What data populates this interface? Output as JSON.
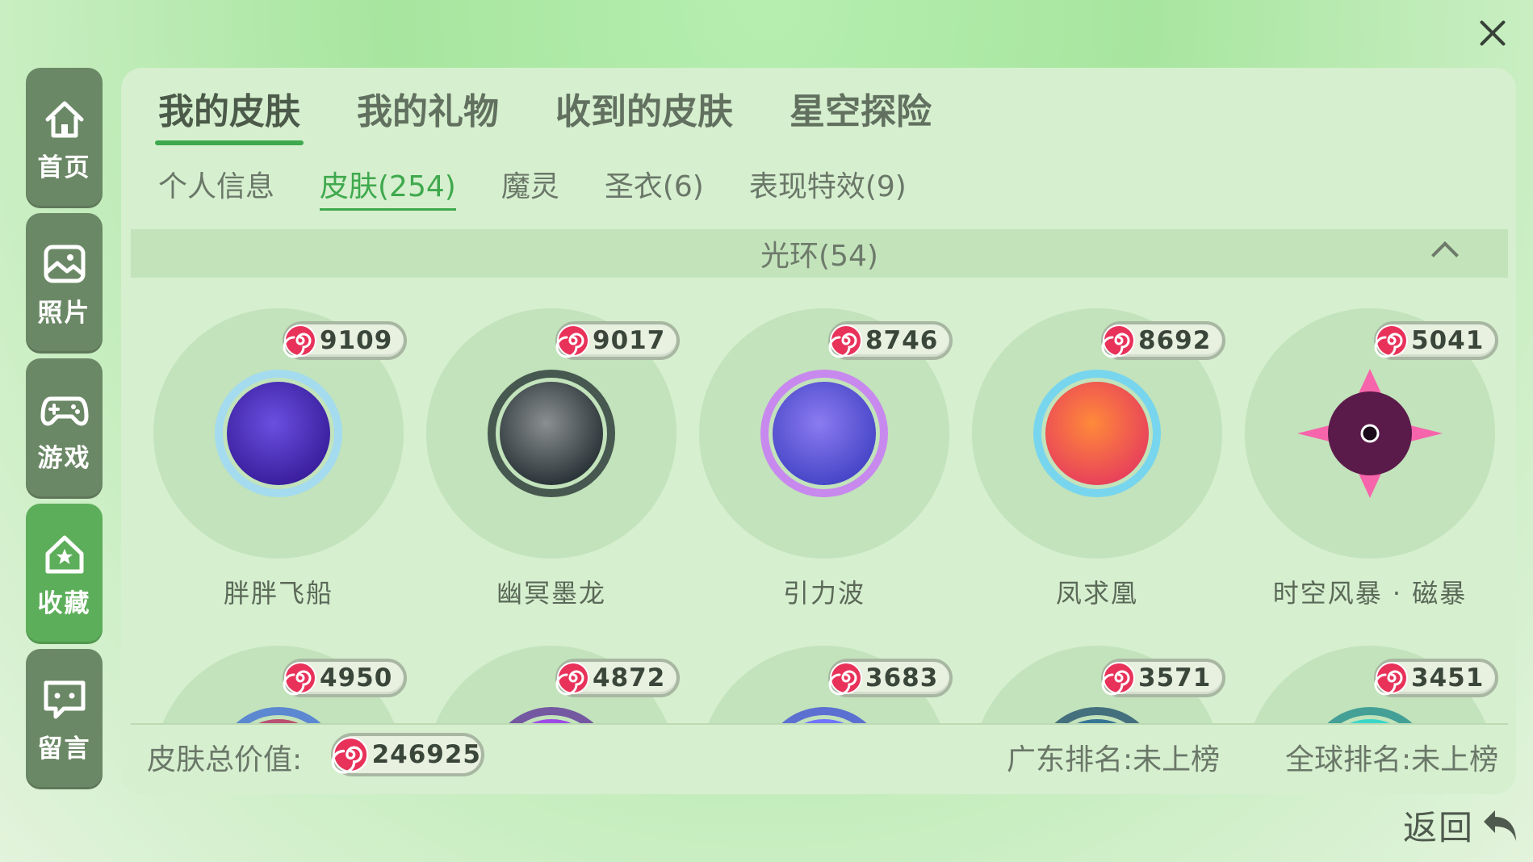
{
  "close_icon": "close-icon",
  "sidebar": {
    "items": [
      {
        "label": "首页",
        "icon": "home-icon",
        "active": false
      },
      {
        "label": "照片",
        "icon": "photo-icon",
        "active": false
      },
      {
        "label": "游戏",
        "icon": "gamepad-icon",
        "active": false
      },
      {
        "label": "收藏",
        "icon": "star-house-icon",
        "active": true
      },
      {
        "label": "留言",
        "icon": "message-icon",
        "active": false
      }
    ]
  },
  "tabs": [
    {
      "label": "我的皮肤",
      "active": true
    },
    {
      "label": "我的礼物",
      "active": false
    },
    {
      "label": "收到的皮肤",
      "active": false
    },
    {
      "label": "星空探险",
      "active": false
    }
  ],
  "subtabs": [
    {
      "label": "个人信息",
      "active": false
    },
    {
      "label": "皮肤(254)",
      "active": true
    },
    {
      "label": "魔灵",
      "active": false
    },
    {
      "label": "圣衣(6)",
      "active": false
    },
    {
      "label": "表现特效(9)",
      "active": false
    }
  ],
  "section": {
    "title": "光环(54)",
    "expanded": true
  },
  "items": [
    {
      "name": "胖胖飞船",
      "price": "9109",
      "colors": [
        "#3a1f9e",
        "#6a4fe0",
        "#9ad8ff"
      ]
    },
    {
      "name": "幽冥墨龙",
      "price": "9017",
      "colors": [
        "#2b3438",
        "#8a9091",
        "#1e2a2c"
      ]
    },
    {
      "name": "引力波",
      "price": "8746",
      "colors": [
        "#4746c8",
        "#8b7bf0",
        "#c96bff"
      ]
    },
    {
      "name": "凤求凰",
      "price": "8692",
      "colors": [
        "#e8425a",
        "#ff8a3a",
        "#5fd0ff"
      ]
    },
    {
      "name": "时空风暴 · 磁暴",
      "price": "5041",
      "colors": [
        "#5a1a4a",
        "#ff4fa8",
        "#1a0a1a"
      ]
    },
    {
      "name": "",
      "price": "4950",
      "colors": [
        "#d44a3a",
        "#8a5ad8",
        "#3a6ad8"
      ]
    },
    {
      "name": "",
      "price": "4872",
      "colors": [
        "#8a3ad8",
        "#c06aff",
        "#5a2a9a"
      ]
    },
    {
      "name": "",
      "price": "3683",
      "colors": [
        "#5a7aff",
        "#9a6aff",
        "#3a4ad8"
      ]
    },
    {
      "name": "",
      "price": "3571",
      "colors": [
        "#2a6a8a",
        "#4a8aaa",
        "#1a4a6a"
      ]
    },
    {
      "name": "",
      "price": "3451",
      "colors": [
        "#2ad0c0",
        "#5ae0d8",
        "#1a8a8a"
      ]
    }
  ],
  "footer": {
    "total_label": "皮肤总价值:",
    "total_value": "246925",
    "rank_province": "广东排名:未上榜",
    "rank_global": "全球排名:未上榜"
  },
  "back": {
    "label": "返回",
    "icon": "back-arrow-icon"
  }
}
